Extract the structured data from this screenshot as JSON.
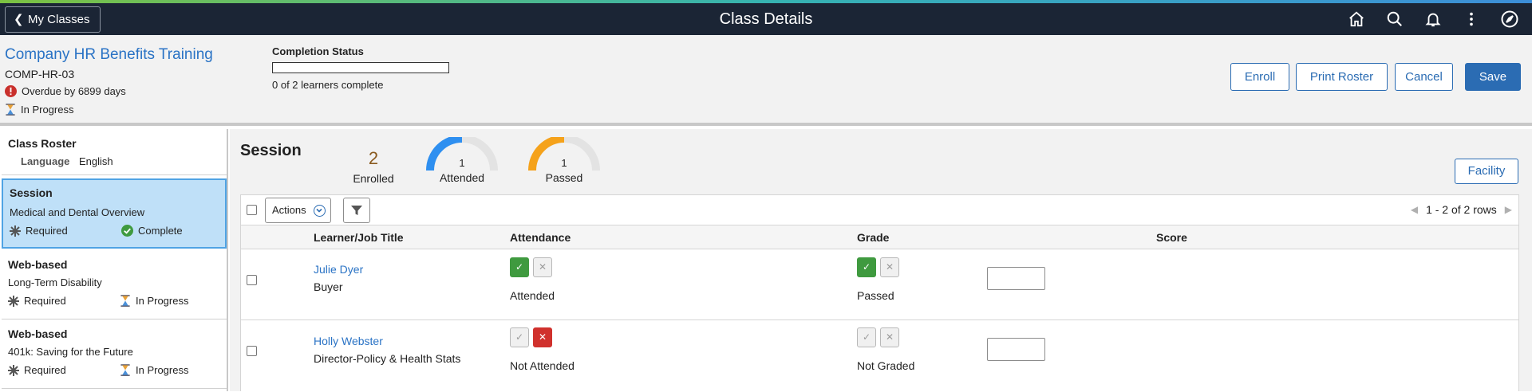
{
  "header": {
    "back_label": "My Classes",
    "title": "Class Details",
    "icons": [
      "home-icon",
      "search-icon",
      "bell-icon",
      "more-vertical-icon",
      "navbar-compass-icon"
    ]
  },
  "summary": {
    "course_title": "Company HR Benefits Training",
    "course_code": "COMP-HR-03",
    "overdue": "Overdue by 6899 days",
    "status": "In Progress",
    "completion_label": "Completion Status",
    "completion_fraction": 0,
    "completion_text": "0 of 2 learners complete",
    "buttons": {
      "enroll": "Enroll",
      "print": "Print Roster",
      "cancel": "Cancel",
      "save": "Save"
    }
  },
  "left_panel": {
    "roster": {
      "title": "Class Roster",
      "language_label": "Language",
      "language_value": "English"
    },
    "items": [
      {
        "title": "Session",
        "subtitle": "Medical and Dental Overview",
        "required": "Required",
        "status": "Complete"
      },
      {
        "title": "Web-based",
        "subtitle": "Long-Term Disability",
        "required": "Required",
        "status": "In Progress"
      },
      {
        "title": "Web-based",
        "subtitle": "401k: Saving for the Future",
        "required": "Required",
        "status": "In Progress"
      }
    ]
  },
  "main": {
    "title": "Session",
    "enrolled": {
      "value": "2",
      "label": "Enrolled"
    },
    "attended": {
      "value": "1",
      "label": "Attended",
      "fraction": 0.5,
      "color": "#2e8ff0"
    },
    "passed": {
      "value": "1",
      "label": "Passed",
      "fraction": 0.5,
      "color": "#f5a21b"
    },
    "facility_label": "Facility",
    "actions_label": "Actions",
    "pager_text": "1 - 2 of 2 rows",
    "columns": {
      "learner": "Learner/Job Title",
      "attendance": "Attendance",
      "grade": "Grade",
      "score": "Score"
    },
    "rows": [
      {
        "name": "Julie Dyer",
        "job": "Buyer",
        "attendance": "Attended",
        "grade": "Passed"
      },
      {
        "name": "Holly Webster",
        "job": "Director-Policy & Health Stats",
        "attendance": "Not Attended",
        "grade": "Not Graded"
      }
    ]
  },
  "colors": {
    "header_bg": "#1b2535",
    "link": "#2a73c5",
    "primary": "#2b6cb3",
    "selected_bg": "#bfe0f8",
    "green": "#3f9a3f",
    "red": "#d0312d"
  }
}
